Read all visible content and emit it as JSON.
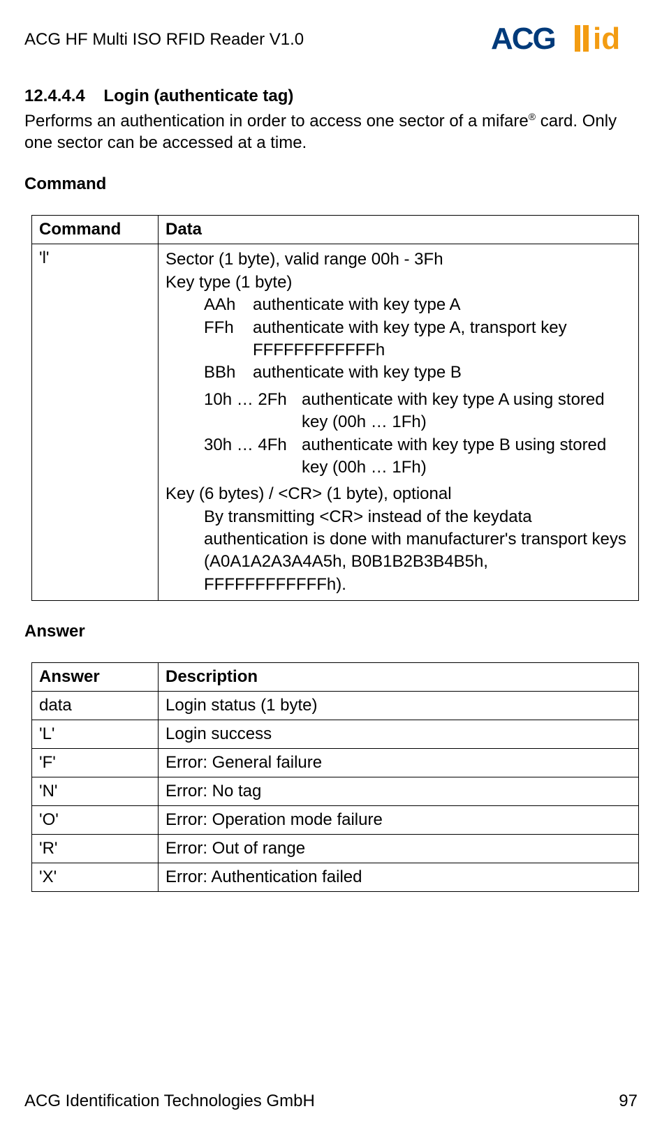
{
  "header": {
    "doc_title": "ACG HF Multi ISO RFID Reader V1.0",
    "logo_main": "ACG",
    "logo_sub": "id"
  },
  "section": {
    "number": "12.4.4.4",
    "title": "Login (authenticate tag)",
    "intro_a": "Performs an authentication in order to access one sector of a mifare",
    "intro_sup": "®",
    "intro_b": " card. Only one sector can be accessed at a time."
  },
  "command": {
    "heading": "Command",
    "th_cmd": "Command",
    "th_data": "Data",
    "cmd_char": "'l'",
    "sector_line": "Sector (1 byte), valid range 00h - 3Fh",
    "keytype_line": "Key type (1 byte)",
    "aah_k": "AAh",
    "aah_v": "authenticate with key type A",
    "ffh_k": "FFh",
    "ffh_v": "authenticate with key type A, transport key FFFFFFFFFFFFh",
    "bbh_k": "BBh",
    "bbh_v": "authenticate with key type B",
    "r1_k": "10h … 2Fh",
    "r1_v": "authenticate with key type A using stored key (00h … 1Fh)",
    "r2_k": "30h … 4Fh",
    "r2_v": "authenticate with key type B using stored key (00h … 1Fh)",
    "key_line": "Key (6 bytes) / <CR> (1 byte), optional",
    "key_detail": "By transmitting <CR> instead of the keydata authentication is done with manufacturer's transport keys (A0A1A2A3A4A5h, B0B1B2B3B4B5h, FFFFFFFFFFFFh)."
  },
  "answer": {
    "heading": "Answer",
    "th_ans": "Answer",
    "th_desc": "Description",
    "rows": [
      {
        "a": "data",
        "d": "Login status (1 byte)"
      },
      {
        "a": "'L'",
        "d": "Login success"
      },
      {
        "a": "'F'",
        "d": "Error: General failure"
      },
      {
        "a": "'N'",
        "d": "Error: No tag"
      },
      {
        "a": "'O'",
        "d": "Error: Operation mode failure"
      },
      {
        "a": "'R'",
        "d": "Error: Out of range"
      },
      {
        "a": "'X'",
        "d": "Error: Authentication failed"
      }
    ]
  },
  "footer": {
    "left": "ACG Identification Technologies GmbH",
    "right": "97"
  }
}
